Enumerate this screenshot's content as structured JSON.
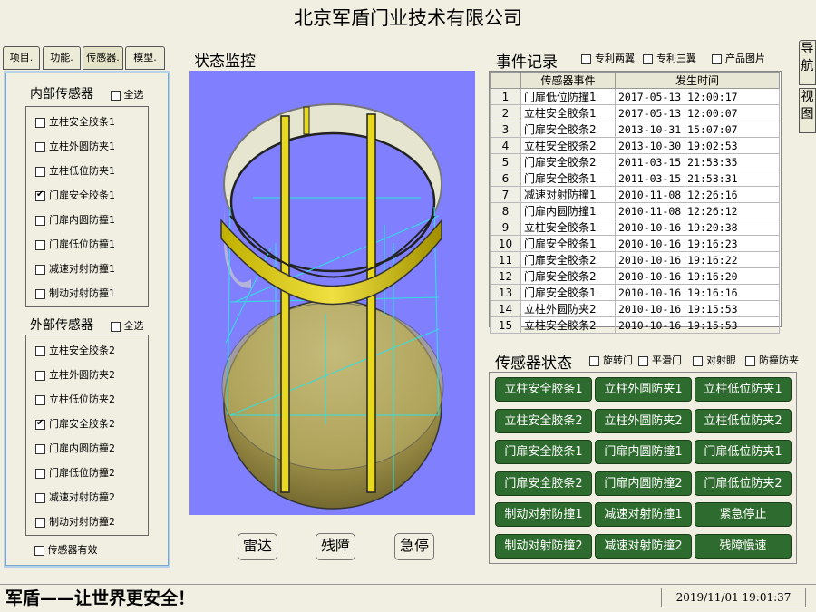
{
  "app_title": "北京军盾门业技术有限公司",
  "tabs": [
    "项目.",
    "功能.",
    "传感器.",
    "模型."
  ],
  "inner": {
    "title": "内部传感器",
    "select_all": "全选",
    "items": [
      {
        "label": "立柱安全胶条1",
        "checked": false
      },
      {
        "label": "立柱外圆防夹1",
        "checked": false
      },
      {
        "label": "立柱低位防夹1",
        "checked": false
      },
      {
        "label": "门扉安全胶条1",
        "checked": true
      },
      {
        "label": "门扉内圆防撞1",
        "checked": false
      },
      {
        "label": "门扉低位防撞1",
        "checked": false
      },
      {
        "label": "减速对射防撞1",
        "checked": false
      },
      {
        "label": "制动对射防撞1",
        "checked": false
      }
    ]
  },
  "outer": {
    "title": "外部传感器",
    "select_all": "全选",
    "items": [
      {
        "label": "立柱安全胶条2",
        "checked": false
      },
      {
        "label": "立柱外圆防夹2",
        "checked": false
      },
      {
        "label": "立柱低位防夹2",
        "checked": false
      },
      {
        "label": "门扉安全胶条2",
        "checked": true
      },
      {
        "label": "门扉内圆防撞2",
        "checked": false
      },
      {
        "label": "门扉低位防撞2",
        "checked": false
      },
      {
        "label": "减速对射防撞2",
        "checked": false
      },
      {
        "label": "制动对射防撞2",
        "checked": false
      }
    ]
  },
  "sensor_valid": "传感器有效",
  "monitor": {
    "title": "状态监控"
  },
  "buttons": {
    "radar": "雷达",
    "fault": "残障",
    "stop": "急停"
  },
  "events": {
    "title": "事件记录",
    "options": [
      "专利两翼",
      "专利三翼",
      "产品图片"
    ],
    "columns": [
      "传感器事件",
      "发生时间"
    ],
    "rows": [
      [
        "1",
        "门扉低位防撞1",
        "2017-05-13 12:00:17"
      ],
      [
        "2",
        "立柱安全胶条1",
        "2017-05-13 12:00:07"
      ],
      [
        "3",
        "门扉安全胶条2",
        "2013-10-31 15:07:07"
      ],
      [
        "4",
        "立柱安全胶条2",
        "2013-10-30 19:02:53"
      ],
      [
        "5",
        "门扉安全胶条2",
        "2011-03-15 21:53:35"
      ],
      [
        "6",
        "门扉安全胶条1",
        "2011-03-15 21:53:31"
      ],
      [
        "7",
        "减速对射防撞1",
        "2010-11-08 12:26:16"
      ],
      [
        "8",
        "门扉内圆防撞1",
        "2010-11-08 12:26:12"
      ],
      [
        "9",
        "立柱安全胶条1",
        "2010-10-16 19:20:38"
      ],
      [
        "10",
        "门扉安全胶条1",
        "2010-10-16 19:16:23"
      ],
      [
        "11",
        "门扉安全胶条2",
        "2010-10-16 19:16:22"
      ],
      [
        "12",
        "门扉安全胶条2",
        "2010-10-16 19:16:20"
      ],
      [
        "13",
        "门扉安全胶条1",
        "2010-10-16 19:16:16"
      ],
      [
        "14",
        "立柱外圆防夹2",
        "2010-10-16 19:15:53"
      ],
      [
        "15",
        "立柱安全胶条2",
        "2010-10-16 19:15:53"
      ]
    ]
  },
  "sensor_status": {
    "title": "传感器状态",
    "options": [
      "旋转门",
      "平滑门",
      "对射眼",
      "防撞防夹"
    ],
    "buttons": [
      "立柱安全胶条1",
      "立柱外圆防夹1",
      "立柱低位防夹1",
      "立柱安全胶条2",
      "立柱外圆防夹2",
      "立柱低位防夹2",
      "门扉安全胶条1",
      "门扉内圆防撞1",
      "门扉低位防夹1",
      "门扉安全胶条2",
      "门扉内圆防撞2",
      "门扉低位防夹2",
      "制动对射防撞1",
      "减速对射防撞1",
      "紧急停止",
      "制动对射防撞2",
      "减速对射防撞2",
      "残障慢速"
    ]
  },
  "nav_tabs": [
    "导航",
    "视图"
  ],
  "slogan": "军盾——让世界更安全！",
  "clock": "2019/11/01  19:01:37",
  "colors": {
    "monitor_bg": "#8080ff",
    "status_button": "#2e6b2e",
    "pillar": "#e8d820"
  }
}
